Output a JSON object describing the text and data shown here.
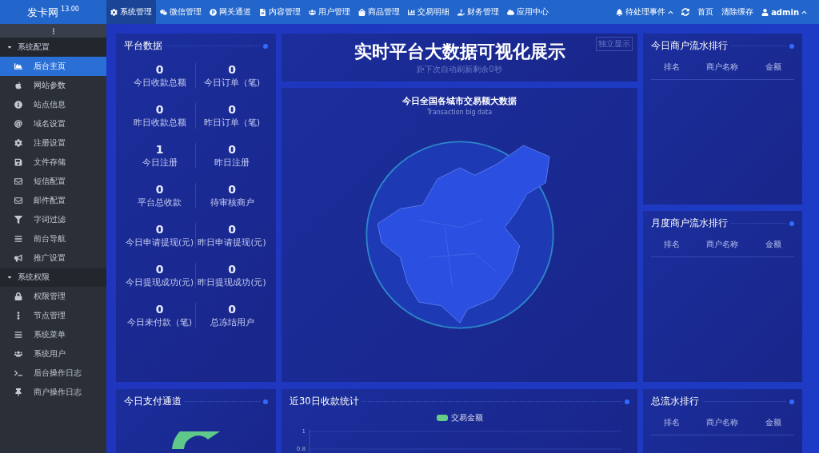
{
  "topbar": {
    "brand": "发卡网",
    "version": "13.00",
    "nav": [
      {
        "label": "系统管理",
        "selected": true
      },
      {
        "label": "微信管理",
        "selected": false
      },
      {
        "label": "网关通道",
        "selected": false
      },
      {
        "label": "内容管理",
        "selected": false
      },
      {
        "label": "用户管理",
        "selected": false
      },
      {
        "label": "商品管理",
        "selected": false
      },
      {
        "label": "交易明细",
        "selected": false
      },
      {
        "label": "财务管理",
        "selected": false
      },
      {
        "label": "应用中心",
        "selected": false
      }
    ],
    "right": [
      {
        "kind": "events",
        "label": "待处理事件"
      },
      {
        "kind": "refresh"
      },
      {
        "kind": "link",
        "label": "首页"
      },
      {
        "kind": "link",
        "label": "清除缓存"
      },
      {
        "kind": "user",
        "label": "admin"
      }
    ]
  },
  "sidebar": {
    "groups": [
      {
        "label": "系统配置",
        "expanded": true,
        "items": [
          {
            "label": "后台主页",
            "selected": true
          },
          {
            "label": "网站参数",
            "selected": false
          },
          {
            "label": "站点信息",
            "selected": false
          },
          {
            "label": "域名设置",
            "selected": false
          },
          {
            "label": "注册设置",
            "selected": false
          },
          {
            "label": "文件存储",
            "selected": false
          },
          {
            "label": "短信配置",
            "selected": false
          },
          {
            "label": "邮件配置",
            "selected": false
          },
          {
            "label": "字词过滤",
            "selected": false
          },
          {
            "label": "前台导航",
            "selected": false
          },
          {
            "label": "推广设置",
            "selected": false
          }
        ]
      },
      {
        "label": "系统权限",
        "expanded": true,
        "items": [
          {
            "label": "权限管理",
            "selected": false
          },
          {
            "label": "节点管理",
            "selected": false
          },
          {
            "label": "系统菜单",
            "selected": false
          },
          {
            "label": "系统用户",
            "selected": false
          },
          {
            "label": "后台操作日志",
            "selected": false
          },
          {
            "label": "商户操作日志",
            "selected": false
          }
        ]
      }
    ]
  },
  "platform": {
    "title": "平台数据",
    "stats": [
      {
        "value": "0",
        "label": "今日收款总额"
      },
      {
        "value": "0",
        "label": "今日订单（笔)"
      },
      {
        "value": "0",
        "label": "昨日收款总额"
      },
      {
        "value": "0",
        "label": "昨日订单（笔)"
      },
      {
        "value": "1",
        "label": "今日注册"
      },
      {
        "value": "0",
        "label": "昨日注册"
      },
      {
        "value": "0",
        "label": "平台总收款"
      },
      {
        "value": "0",
        "label": "待审核商户"
      },
      {
        "value": "0",
        "label": "今日申请提现(元)"
      },
      {
        "value": "0",
        "label": "昨日申请提现(元)"
      },
      {
        "value": "0",
        "label": "今日提现成功(元)"
      },
      {
        "value": "0",
        "label": "昨日提现成功(元)"
      },
      {
        "value": "0",
        "label": "今日未付款（笔)"
      },
      {
        "value": "0",
        "label": "总冻结用户"
      }
    ]
  },
  "header": {
    "title": "实时平台大数据可视化展示",
    "subtitle": "距下次自动刷新剩余0秒",
    "button": "独立显示"
  },
  "map": {
    "title": "今日全国各城市交易额大数据",
    "subtitle": "Transaction big data"
  },
  "rankings": [
    {
      "title": "今日商户流水排行",
      "columns": [
        "排名",
        "商户名称",
        "金额"
      ]
    },
    {
      "title": "月度商户流水排行",
      "columns": [
        "排名",
        "商户名称",
        "金额"
      ]
    }
  ],
  "payment": {
    "title": "今日支付通道"
  },
  "income": {
    "title": "近30日收款统计",
    "chart_data": {
      "type": "line",
      "series": [
        {
          "name": "交易金额",
          "color": "#66cc88"
        }
      ],
      "yticks": [
        1,
        0.8
      ],
      "ylim": [
        0.8,
        1
      ]
    }
  },
  "total": {
    "title": "总流水排行",
    "columns": [
      "排名",
      "商户名称",
      "金额"
    ]
  }
}
